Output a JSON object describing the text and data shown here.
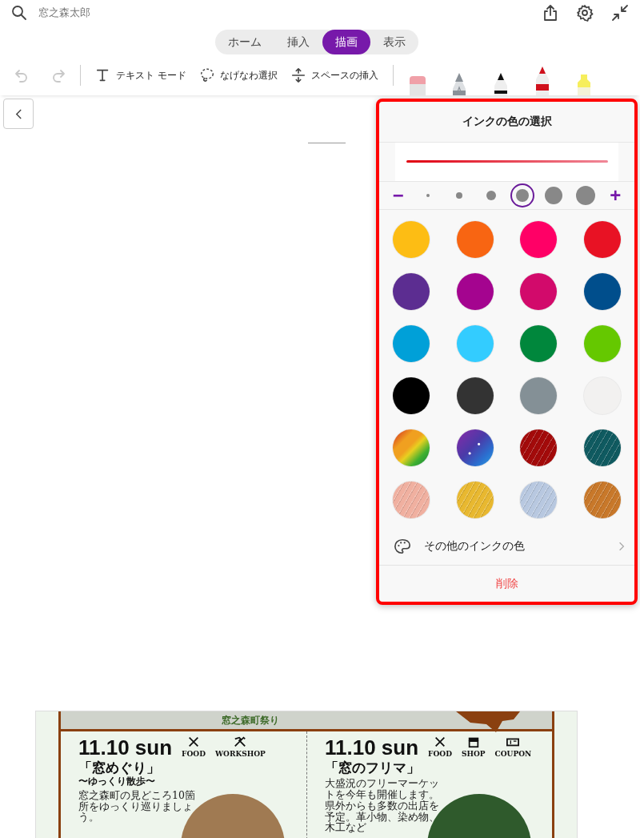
{
  "top_bar": {
    "title": "窓之森太郎"
  },
  "tabs": [
    {
      "label": "ホーム",
      "selected": false
    },
    {
      "label": "挿入",
      "selected": false
    },
    {
      "label": "描画",
      "selected": true
    },
    {
      "label": "表示",
      "selected": false
    }
  ],
  "toolbar": {
    "undo": {
      "disabled": true
    },
    "redo": {
      "disabled": true
    },
    "tools": [
      {
        "label": "テキスト モード",
        "kind": "text"
      },
      {
        "label": "なげなわ選択",
        "kind": "lasso"
      },
      {
        "label": "スペースの挿入",
        "kind": "space"
      }
    ],
    "pens": [
      {
        "kind": "eraser",
        "selected": false
      },
      {
        "kind": "pencil",
        "color": "#8a9198",
        "selected": false
      },
      {
        "kind": "pen",
        "color": "#111111",
        "selected": false
      },
      {
        "kind": "pen",
        "color": "#d0101c",
        "selected": true
      },
      {
        "kind": "highlighter",
        "color": "#f6ee5c",
        "selected": false
      }
    ]
  },
  "ink_panel": {
    "title": "インクの色の選択",
    "minus": "−",
    "plus": "+",
    "sizes": [
      {
        "selected": false
      },
      {
        "selected": false
      },
      {
        "selected": false
      },
      {
        "selected": true
      },
      {
        "selected": false
      },
      {
        "selected": false
      }
    ],
    "swatches": [
      {
        "kind": "solid",
        "color": "#fdbd14"
      },
      {
        "kind": "solid",
        "color": "#f86512"
      },
      {
        "kind": "solid",
        "color": "#ff0066"
      },
      {
        "kind": "solid",
        "color": "#e81224"
      },
      {
        "kind": "solid",
        "color": "#5c2d91"
      },
      {
        "kind": "solid",
        "color": "#a4048f"
      },
      {
        "kind": "solid",
        "color": "#d20a6b"
      },
      {
        "kind": "solid",
        "color": "#004e8c"
      },
      {
        "kind": "solid",
        "color": "#00a0d8"
      },
      {
        "kind": "solid",
        "color": "#33ccff"
      },
      {
        "kind": "solid",
        "color": "#00873c"
      },
      {
        "kind": "solid",
        "color": "#65c800"
      },
      {
        "kind": "solid",
        "color": "#000000"
      },
      {
        "kind": "solid",
        "color": "#333333"
      },
      {
        "kind": "solid",
        "color": "#849096"
      },
      {
        "kind": "solid",
        "color": "#f2f1f0"
      },
      {
        "kind": "rainbow",
        "color": "#f0a020"
      },
      {
        "kind": "galaxy",
        "color": "#4a3aa8"
      },
      {
        "kind": "texture",
        "color": "#a30a0a"
      },
      {
        "kind": "texture",
        "color": "#0f5a60"
      },
      {
        "kind": "texture",
        "color": "#f0b0a0"
      },
      {
        "kind": "texture",
        "color": "#e8b830"
      },
      {
        "kind": "texture",
        "color": "#b8c8e0"
      },
      {
        "kind": "texture",
        "color": "#c8782a"
      }
    ],
    "more_colors": "その他のインクの色",
    "delete": "削除"
  },
  "flyer": {
    "header": "窓之森町祭り",
    "columns": [
      {
        "date": "11.10 sun",
        "tags": [
          {
            "kind": "food",
            "label": "FOOD"
          },
          {
            "kind": "workshop",
            "label": "WORKSHOP"
          }
        ],
        "title": "「窓めぐり」",
        "subtitle": "〜ゆっくり散歩〜",
        "body": "窓之森町の見どころ10箇所をゆっくり巡りましょう。"
      },
      {
        "date": "11.10 sun",
        "tags": [
          {
            "kind": "food",
            "label": "FOOD"
          },
          {
            "kind": "shop",
            "label": "SHOP"
          },
          {
            "kind": "coupon",
            "label": "COUPON"
          }
        ],
        "title": "「窓のフリマ」",
        "body": "大盛況のフリーマーケットを今年も開催します。県外からも多数の出店を予定。革小物、染め物、木工など"
      }
    ]
  }
}
